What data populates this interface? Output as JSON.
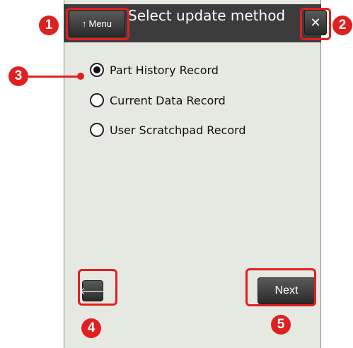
{
  "window": {
    "title": "Select update method"
  },
  "toolbar": {
    "menu_arrow": "↑",
    "menu_label": "Menu",
    "close_label": "✕"
  },
  "options": [
    {
      "label": "Part History Record",
      "selected": true
    },
    {
      "label": "Current Data Record",
      "selected": false
    },
    {
      "label": "User Scratchpad Record",
      "selected": false
    }
  ],
  "footer": {
    "back_label": "🡐",
    "next_label": "Next"
  },
  "callouts": {
    "c1": "1",
    "c2": "2",
    "c3": "3",
    "c4": "4",
    "c5": "5"
  },
  "colors": {
    "callout": "#e02020",
    "panel": "#e6e8e2",
    "titlebar": "#3c3c3c"
  }
}
